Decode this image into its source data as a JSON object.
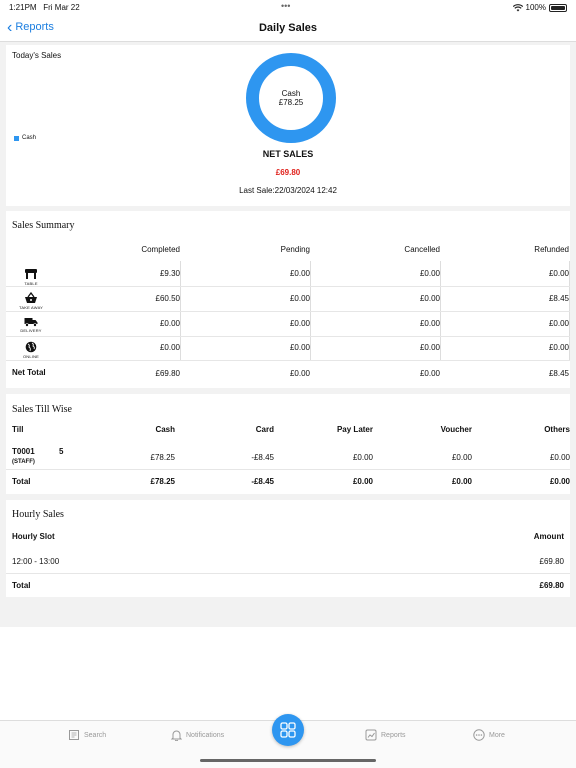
{
  "status_bar": {
    "time": "1:21PM",
    "date": "Fri Mar 22",
    "battery": "100%"
  },
  "nav": {
    "back_label": "Reports",
    "title": "Daily Sales"
  },
  "todays_sales": {
    "title": "Today's Sales",
    "donut_label": "Cash",
    "donut_value": "£78.25",
    "legend_label": "Cash",
    "net_label": "NET SALES",
    "net_value": "£69.80",
    "last_sale": "Last Sale:22/03/2024 12:42",
    "colors": {
      "donut": "#2e96f0",
      "net_value": "#e0211c"
    }
  },
  "sales_summary": {
    "title": "Sales Summary",
    "columns": [
      "Completed",
      "Pending",
      "Cancelled",
      "Refunded"
    ],
    "rows": [
      {
        "icon": "table-icon",
        "label": "TABLE",
        "values": [
          "£9.30",
          "£0.00",
          "£0.00",
          "£0.00"
        ]
      },
      {
        "icon": "basket-icon",
        "label": "TAKE AWAY",
        "values": [
          "£60.50",
          "£0.00",
          "£0.00",
          "£8.45"
        ]
      },
      {
        "icon": "delivery-truck-icon",
        "label": "DELIVERY",
        "values": [
          "£0.00",
          "£0.00",
          "£0.00",
          "£0.00"
        ]
      },
      {
        "icon": "globe-icon",
        "label": "ONLINE",
        "values": [
          "£0.00",
          "£0.00",
          "£0.00",
          "£0.00"
        ]
      }
    ],
    "total_label": "Net Total",
    "totals": [
      "£69.80",
      "£0.00",
      "£0.00",
      "£8.45"
    ]
  },
  "sales_till": {
    "title": "Sales Till Wise",
    "columns": [
      "Till",
      "Cash",
      "Card",
      "Pay Later",
      "Voucher",
      "Others"
    ],
    "row": {
      "till": "T0001",
      "count": "5",
      "staff": "(STAFF)",
      "values": [
        "£78.25",
        "-£8.45",
        "£0.00",
        "£0.00",
        "£0.00"
      ]
    },
    "total_label": "Total",
    "totals": [
      "£78.25",
      "-£8.45",
      "£0.00",
      "£0.00",
      "£0.00"
    ]
  },
  "hourly_sales": {
    "title": "Hourly Sales",
    "col_slot": "Hourly Slot",
    "col_amount": "Amount",
    "row": {
      "slot": "12:00 - 13:00",
      "amount": "£69.80"
    },
    "total_label": "Total",
    "total": "£69.80"
  },
  "tabbar": {
    "search": "Search",
    "notifications": "Notifications",
    "reports": "Reports",
    "more": "More"
  }
}
